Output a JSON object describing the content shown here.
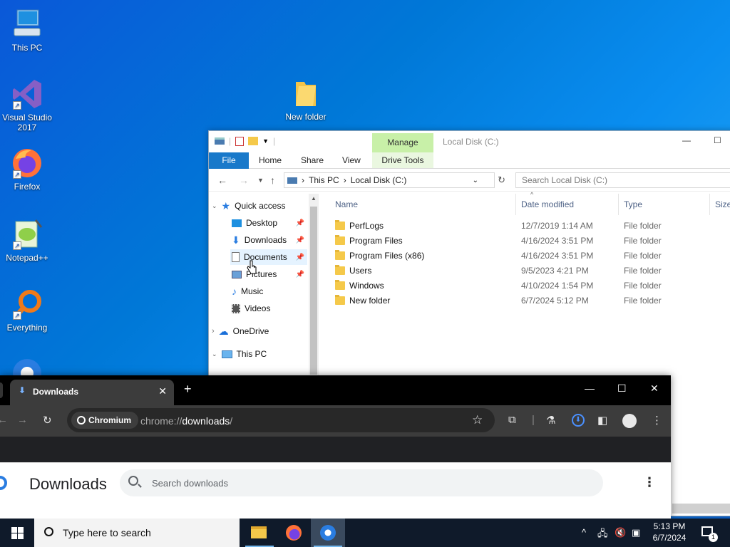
{
  "desktop": {
    "icons": [
      {
        "label": "This PC"
      },
      {
        "label": "Visual Studio 2017"
      },
      {
        "label": "Firefox"
      },
      {
        "label": "Notepad++"
      },
      {
        "label": "Everything"
      },
      {
        "label": "New folder"
      }
    ]
  },
  "explorer": {
    "title": "Local Disk (C:)",
    "manage_tab": "Manage",
    "drive_tools_tab": "Drive Tools",
    "ribbon_tabs": [
      "File",
      "Home",
      "Share",
      "View"
    ],
    "address": {
      "segments": [
        "This PC",
        "Local Disk (C:)"
      ]
    },
    "search_placeholder": "Search Local Disk (C:)",
    "nav_items": [
      {
        "label": "Quick access"
      },
      {
        "label": "Desktop"
      },
      {
        "label": "Downloads"
      },
      {
        "label": "Documents"
      },
      {
        "label": "Pictures"
      },
      {
        "label": "Music"
      },
      {
        "label": "Videos"
      },
      {
        "label": "OneDrive"
      },
      {
        "label": "This PC"
      }
    ],
    "columns": [
      "Name",
      "Date modified",
      "Type",
      "Size"
    ],
    "files": [
      {
        "name": "PerfLogs",
        "date": "12/7/2019 1:14 AM",
        "type": "File folder"
      },
      {
        "name": "Program Files",
        "date": "4/16/2024 3:51 PM",
        "type": "File folder"
      },
      {
        "name": "Program Files (x86)",
        "date": "4/16/2024 3:51 PM",
        "type": "File folder"
      },
      {
        "name": "Users",
        "date": "9/5/2023 4:21 PM",
        "type": "File folder"
      },
      {
        "name": "Windows",
        "date": "4/10/2024 1:54 PM",
        "type": "File folder"
      },
      {
        "name": "New folder",
        "date": "6/7/2024 5:12 PM",
        "type": "File folder"
      }
    ]
  },
  "chrome": {
    "tab_title": "Downloads",
    "chip_label": "Chromium",
    "url_prefix": "chrome://",
    "url_host": "downloads",
    "url_suffix": "/",
    "page_title": "Downloads",
    "search_placeholder": "Search downloads"
  },
  "taskbar": {
    "search_placeholder": "Type here to search",
    "time": "5:13 PM",
    "date": "6/7/2024",
    "notification_count": "1"
  }
}
